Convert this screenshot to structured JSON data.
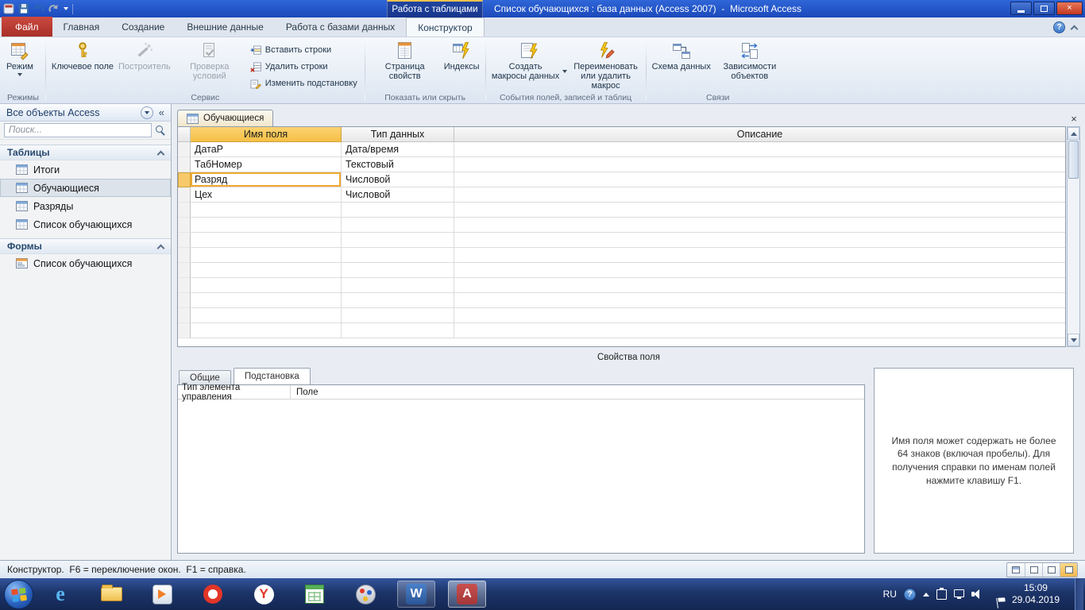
{
  "titlebar": {
    "contextual_tab": "Работа с таблицами",
    "title": "Список обучающихся : база данных (Access 2007)  -  Microsoft Access"
  },
  "tabs": {
    "file": "Файл",
    "home": "Главная",
    "create": "Создание",
    "external": "Внешние данные",
    "dbtools": "Работа с базами данных",
    "design": "Конструктор"
  },
  "ribbon": {
    "view": {
      "label": "Режим",
      "group": "Режимы"
    },
    "tools": {
      "key": "Ключевое поле",
      "builder": "Построитель",
      "test": "Проверка условий",
      "insert": "Вставить строки",
      "delete": "Удалить строки",
      "lookup": "Изменить подстановку",
      "group": "Сервис"
    },
    "showhide": {
      "propsheet": "Страница свойств",
      "indexes": "Индексы",
      "group": "Показать или скрыть"
    },
    "events": {
      "create_macros": "Создать макросы данных",
      "rename_macro": "Переименовать или удалить макрос",
      "group": "События полей, записей и таблиц"
    },
    "relationships": {
      "schema": "Схема данных",
      "dependencies": "Зависимости объектов",
      "group": "Связи"
    }
  },
  "nav": {
    "header": "Все объекты Access",
    "search_placeholder": "Поиск...",
    "tables_section": "Таблицы",
    "forms_section": "Формы",
    "tables": [
      {
        "label": "Итоги"
      },
      {
        "label": "Обучающиеся"
      },
      {
        "label": "Разряды"
      },
      {
        "label": "Список обучающихся"
      }
    ],
    "forms": [
      {
        "label": "Список обучающихся"
      }
    ]
  },
  "doc": {
    "tab": "Обучающиеся",
    "headers": {
      "name": "Имя поля",
      "type": "Тип данных",
      "desc": "Описание"
    },
    "rows": [
      {
        "name": "ДатаР",
        "type": "Дата/время",
        "desc": ""
      },
      {
        "name": "ТабНомер",
        "type": "Текстовый",
        "desc": ""
      },
      {
        "name": "Разряд",
        "type": "Числовой",
        "desc": ""
      },
      {
        "name": "Цех",
        "type": "Числовой",
        "desc": ""
      }
    ],
    "props_band": "Свойства поля",
    "prop_tabs": {
      "general": "Общие",
      "lookup": "Подстановка"
    },
    "prop_row": {
      "label": "Тип элемента управления",
      "value": "Поле"
    },
    "help": "Имя поля может содержать не более 64 знаков (включая пробелы). Для получения справки по именам полей нажмите клавишу F1."
  },
  "status": {
    "text": "Конструктор.  F6 = переключение окон.  F1 = справка."
  },
  "taskbar": {
    "lang": "RU",
    "time": "15:09",
    "date": "29.04.2019",
    "letters": {
      "ie": "e",
      "yandex": "Y",
      "word": "W",
      "access": "A"
    }
  },
  "icons": {
    "close_window": "×",
    "help": "?",
    "collapse_pane": "«"
  }
}
